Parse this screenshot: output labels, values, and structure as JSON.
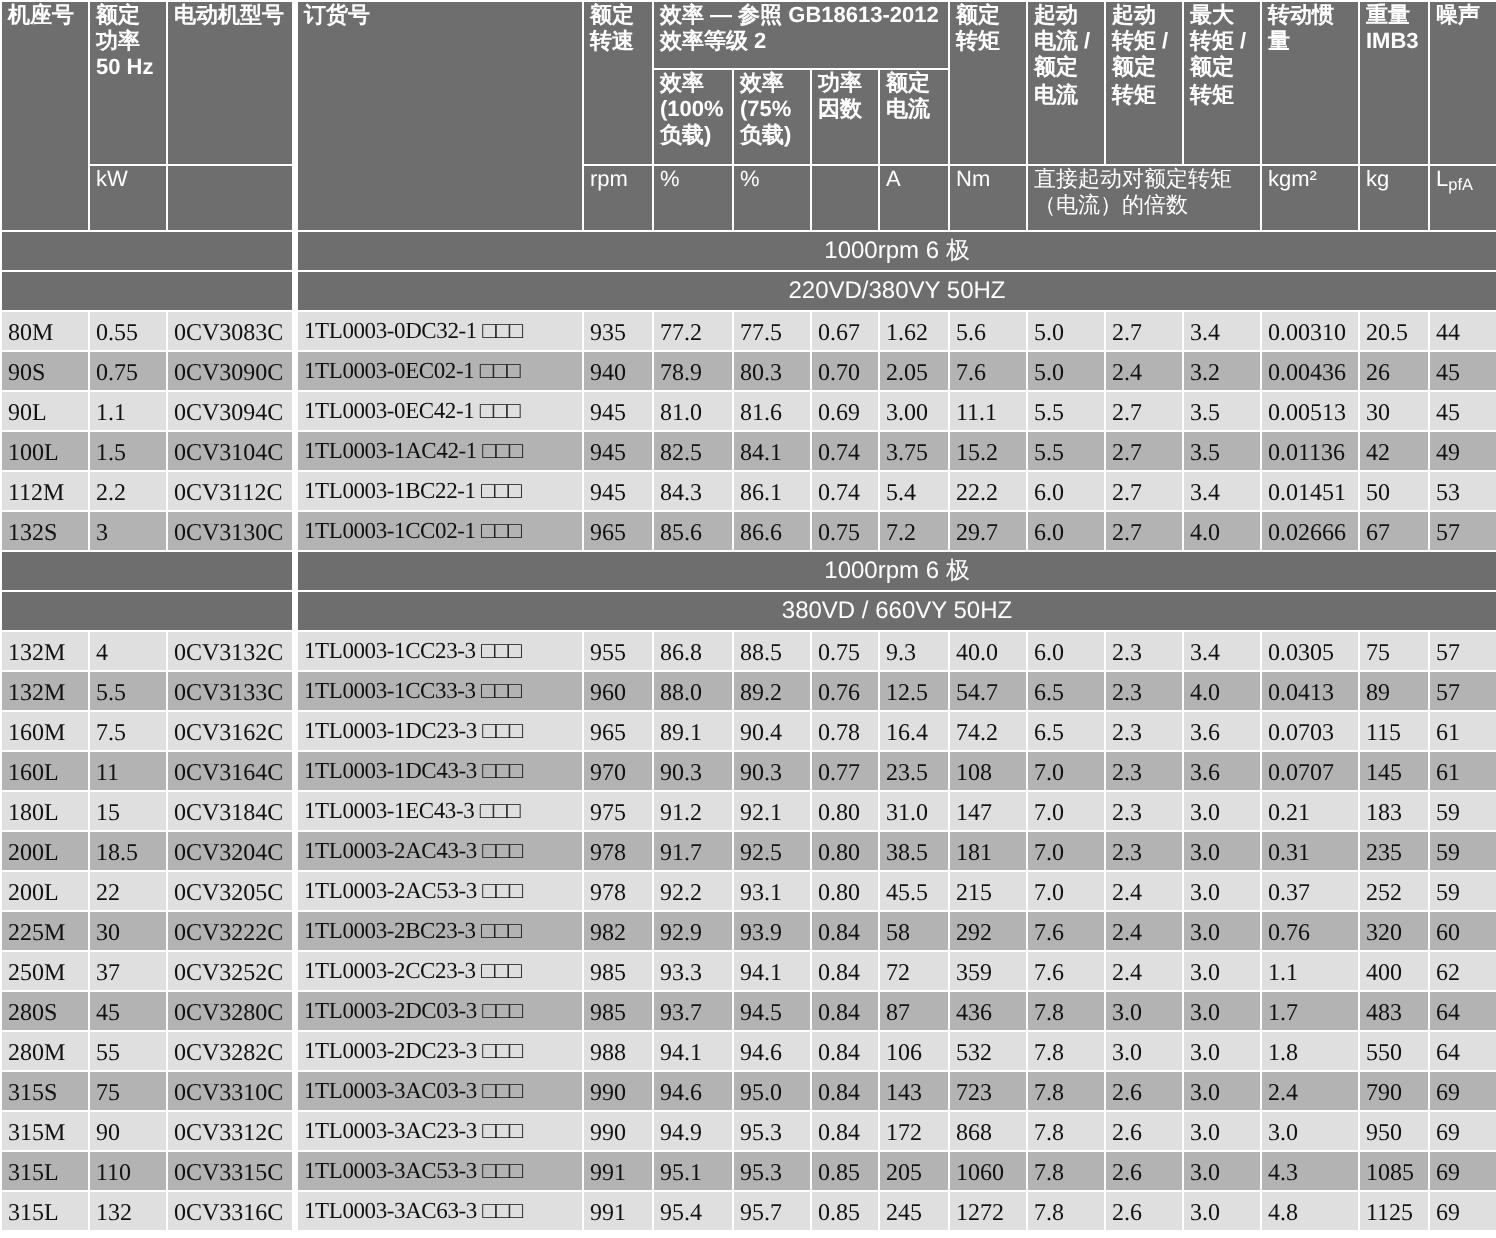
{
  "table": {
    "columns": [
      {
        "label": "机座号"
      },
      {
        "label": "额定功率50 Hz",
        "unit": "kW"
      },
      {
        "label": "电动机型号"
      },
      {
        "label": "订货号"
      },
      {
        "label": "额定转速",
        "unit": "rpm"
      },
      {
        "label": "效率(100%负载)",
        "unit": "%"
      },
      {
        "label": "效率(75%负载)",
        "unit": "%"
      },
      {
        "label": "功率因数"
      },
      {
        "label": "额定电流",
        "unit": "A"
      },
      {
        "label": "额定转矩",
        "unit": "Nm"
      },
      {
        "label": "起动电流 / 额定电流"
      },
      {
        "label": "起动转矩 / 额定转矩"
      },
      {
        "label": "最大转矩 / 额定转矩"
      },
      {
        "label": "转动惯量",
        "unit": "kgm²"
      },
      {
        "label": "重量 IMB3",
        "unit": "kg"
      },
      {
        "label": "噪声",
        "unit": "L$_{pfA}$"
      }
    ],
    "efficiency_group": "效率 — 参照 GB18613-2012 效率等级 2",
    "ratio_unit": "直接起动对额定转矩（电流）的倍数",
    "sections": [
      {
        "speed": "1000rpm  6 极",
        "voltage": "220VD/380VY  50HZ",
        "rows": [
          [
            "80M",
            "0.55",
            "0CV3083C",
            "1TL0003-0DC32-1 □□□",
            "935",
            "77.2",
            "77.5",
            "0.67",
            "1.62",
            "5.6",
            "5.0",
            "2.7",
            "3.4",
            "0.00310",
            "20.5",
            "44"
          ],
          [
            "90S",
            "0.75",
            "0CV3090C",
            "1TL0003-0EC02-1 □□□",
            "940",
            "78.9",
            "80.3",
            "0.70",
            "2.05",
            "7.6",
            "5.0",
            "2.4",
            "3.2",
            "0.00436",
            "26",
            "45"
          ],
          [
            "90L",
            "1.1",
            "0CV3094C",
            "1TL0003-0EC42-1 □□□",
            "945",
            "81.0",
            "81.6",
            "0.69",
            "3.00",
            "11.1",
            "5.5",
            "2.7",
            "3.5",
            "0.00513",
            "30",
            "45"
          ],
          [
            "100L",
            "1.5",
            "0CV3104C",
            "1TL0003-1AC42-1 □□□",
            "945",
            "82.5",
            "84.1",
            "0.74",
            "3.75",
            "15.2",
            "5.5",
            "2.7",
            "3.5",
            "0.01136",
            "42",
            "49"
          ],
          [
            "112M",
            "2.2",
            "0CV3112C",
            "1TL0003-1BC22-1 □□□",
            "945",
            "84.3",
            "86.1",
            "0.74",
            "5.4",
            "22.2",
            "6.0",
            "2.7",
            "3.4",
            "0.01451",
            "50",
            "53"
          ],
          [
            "132S",
            "3",
            "0CV3130C",
            "1TL0003-1CC02-1 □□□",
            "965",
            "85.6",
            "86.6",
            "0.75",
            "7.2",
            "29.7",
            "6.0",
            "2.7",
            "4.0",
            "0.02666",
            "67",
            "57"
          ]
        ]
      },
      {
        "speed": "1000rpm  6 极",
        "voltage": "380VD / 660VY  50HZ",
        "rows": [
          [
            "132M",
            "4",
            "0CV3132C",
            "1TL0003-1CC23-3 □□□",
            "955",
            "86.8",
            "88.5",
            "0.75",
            "9.3",
            "40.0",
            "6.0",
            "2.3",
            "3.4",
            "0.0305",
            "75",
            "57"
          ],
          [
            "132M",
            "5.5",
            "0CV3133C",
            "1TL0003-1CC33-3 □□□",
            "960",
            "88.0",
            "89.2",
            "0.76",
            "12.5",
            "54.7",
            "6.5",
            "2.3",
            "4.0",
            "0.0413",
            "89",
            "57"
          ],
          [
            "160M",
            "7.5",
            "0CV3162C",
            "1TL0003-1DC23-3 □□□",
            "965",
            "89.1",
            "90.4",
            "0.78",
            "16.4",
            "74.2",
            "6.5",
            "2.3",
            "3.6",
            "0.0703",
            "115",
            "61"
          ],
          [
            "160L",
            "11",
            "0CV3164C",
            "1TL0003-1DC43-3 □□□",
            "970",
            "90.3",
            "90.3",
            "0.77",
            "23.5",
            "108",
            "7.0",
            "2.3",
            "3.6",
            "0.0707",
            "145",
            "61"
          ],
          [
            "180L",
            "15",
            "0CV3184C",
            "1TL0003-1EC43-3 □□□",
            "975",
            "91.2",
            "92.1",
            "0.80",
            "31.0",
            "147",
            "7.0",
            "2.3",
            "3.0",
            "0.21",
            "183",
            "59"
          ],
          [
            "200L",
            "18.5",
            "0CV3204C",
            "1TL0003-2AC43-3 □□□",
            "978",
            "91.7",
            "92.5",
            "0.80",
            "38.5",
            "181",
            "7.0",
            "2.3",
            "3.0",
            "0.31",
            "235",
            "59"
          ],
          [
            "200L",
            "22",
            "0CV3205C",
            "1TL0003-2AC53-3 □□□",
            "978",
            "92.2",
            "93.1",
            "0.80",
            "45.5",
            "215",
            "7.0",
            "2.4",
            "3.0",
            "0.37",
            "252",
            "59"
          ],
          [
            "225M",
            "30",
            "0CV3222C",
            "1TL0003-2BC23-3 □□□",
            "982",
            "92.9",
            "93.9",
            "0.84",
            "58",
            "292",
            "7.6",
            "2.4",
            "3.0",
            "0.76",
            "320",
            "60"
          ],
          [
            "250M",
            "37",
            "0CV3252C",
            "1TL0003-2CC23-3 □□□",
            "985",
            "93.3",
            "94.1",
            "0.84",
            "72",
            "359",
            "7.6",
            "2.4",
            "3.0",
            "1.1",
            "400",
            "62"
          ],
          [
            "280S",
            "45",
            "0CV3280C",
            "1TL0003-2DC03-3 □□□",
            "985",
            "93.7",
            "94.5",
            "0.84",
            "87",
            "436",
            "7.8",
            "3.0",
            "3.0",
            "1.7",
            "483",
            "64"
          ],
          [
            "280M",
            "55",
            "0CV3282C",
            "1TL0003-2DC23-3 □□□",
            "988",
            "94.1",
            "94.6",
            "0.84",
            "106",
            "532",
            "7.8",
            "3.0",
            "3.0",
            "1.8",
            "550",
            "64"
          ],
          [
            "315S",
            "75",
            "0CV3310C",
            "1TL0003-3AC03-3 □□□",
            "990",
            "94.6",
            "95.0",
            "0.84",
            "143",
            "723",
            "7.8",
            "2.6",
            "3.0",
            "2.4",
            "790",
            "69"
          ],
          [
            "315M",
            "90",
            "0CV3312C",
            "1TL0003-3AC23-3 □□□",
            "990",
            "94.9",
            "95.3",
            "0.84",
            "172",
            "868",
            "7.8",
            "2.6",
            "3.0",
            "3.0",
            "950",
            "69"
          ],
          [
            "315L",
            "110",
            "0CV3315C",
            "1TL0003-3AC53-3 □□□",
            "991",
            "95.1",
            "95.3",
            "0.85",
            "205",
            "1060",
            "7.8",
            "2.6",
            "3.0",
            "4.3",
            "1085",
            "69"
          ],
          [
            "315L",
            "132",
            "0CV3316C",
            "1TL0003-3AC63-3 □□□",
            "991",
            "95.4",
            "95.7",
            "0.85",
            "245",
            "1272",
            "7.8",
            "2.6",
            "3.0",
            "4.8",
            "1125",
            "69"
          ]
        ]
      }
    ]
  }
}
